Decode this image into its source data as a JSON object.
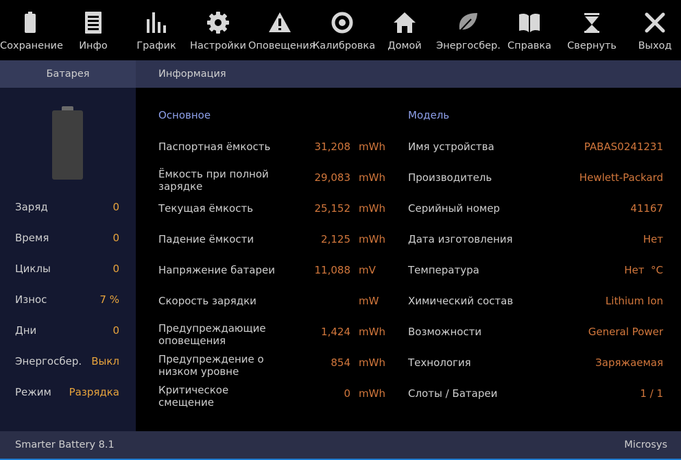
{
  "toolbar": {
    "buttons": [
      {
        "label": "Сохранение",
        "icon": "battery-icon"
      },
      {
        "label": "Инфо",
        "icon": "document-icon"
      },
      {
        "label": "График",
        "icon": "bar-chart-icon"
      },
      {
        "label": "Настройки",
        "icon": "gear-icon"
      },
      {
        "label": "Оповещения",
        "icon": "warning-icon"
      },
      {
        "label": "Калибровка",
        "icon": "target-icon"
      },
      {
        "label": "Домой",
        "icon": "home-icon"
      },
      {
        "label": "Энергосбер.",
        "icon": "leaf-icon"
      },
      {
        "label": "Справка",
        "icon": "book-icon"
      },
      {
        "label": "Свернуть",
        "icon": "minimize-icon"
      },
      {
        "label": "Выход",
        "icon": "close-icon"
      }
    ]
  },
  "tabs": {
    "battery": "Батарея",
    "info": "Информация"
  },
  "left": {
    "rows": [
      {
        "label": "Заряд",
        "value": "0"
      },
      {
        "label": "Время",
        "value": "0"
      },
      {
        "label": "Циклы",
        "value": "0"
      },
      {
        "label": "Износ",
        "value": "7 %"
      },
      {
        "label": "Дни",
        "value": "0"
      },
      {
        "label": "Энергосбер.",
        "value": "Выкл"
      },
      {
        "label": "Режим",
        "value": "Разрядка"
      }
    ]
  },
  "basic": {
    "title": "Основное",
    "rows": [
      {
        "label1": "Паспортная ёмкость",
        "label2": "",
        "value": "31,208",
        "unit": "mWh"
      },
      {
        "label1": "Ёмкость при полной",
        "label2": "зарядке",
        "value": "29,083",
        "unit": "mWh"
      },
      {
        "label1": "Текущая ёмкость",
        "label2": "",
        "value": "25,152",
        "unit": "mWh"
      },
      {
        "label1": "Падение ёмкости",
        "label2": "",
        "value": "2,125",
        "unit": "mWh"
      },
      {
        "label1": "Напряжение батареи",
        "label2": "",
        "value": "11,088",
        "unit": "mV"
      },
      {
        "label1": "Скорость зарядки",
        "label2": "",
        "value": "",
        "unit": "mW"
      },
      {
        "label1": "Предупреждающие",
        "label2": "оповещения",
        "value": "1,424",
        "unit": "mWh"
      },
      {
        "label1": "Предупреждение о",
        "label2": "низком уровне",
        "value": "854",
        "unit": "mWh"
      },
      {
        "label1": "Критическое",
        "label2": "смещение",
        "value": "0",
        "unit": "mWh"
      }
    ]
  },
  "model": {
    "title": "Модель",
    "rows": [
      {
        "label": "Имя устройства",
        "value": "PABAS0241231"
      },
      {
        "label": "Производитель",
        "value": "Hewlett-Packard"
      },
      {
        "label": "Серийный номер",
        "value": "41167"
      },
      {
        "label": "Дата изготовления",
        "value": "Нет"
      },
      {
        "label": "Температура",
        "value": "Нет  °C"
      },
      {
        "label": "Химический состав",
        "value": "Lithium Ion"
      },
      {
        "label": "Возможности",
        "value": "General Power"
      },
      {
        "label": "Технология",
        "value": "Заряжаемая"
      },
      {
        "label": "Слоты / Батареи",
        "value": "1 / 1"
      }
    ]
  },
  "status": {
    "app": "Smarter Battery 8.1",
    "vendor": "Microsys"
  },
  "colors": {
    "accent_value": "#d2773c",
    "left_value": "#e8a43c",
    "section_title": "#8ea0ea",
    "header_bar": "#2e3350",
    "left_panel": "#141830"
  }
}
